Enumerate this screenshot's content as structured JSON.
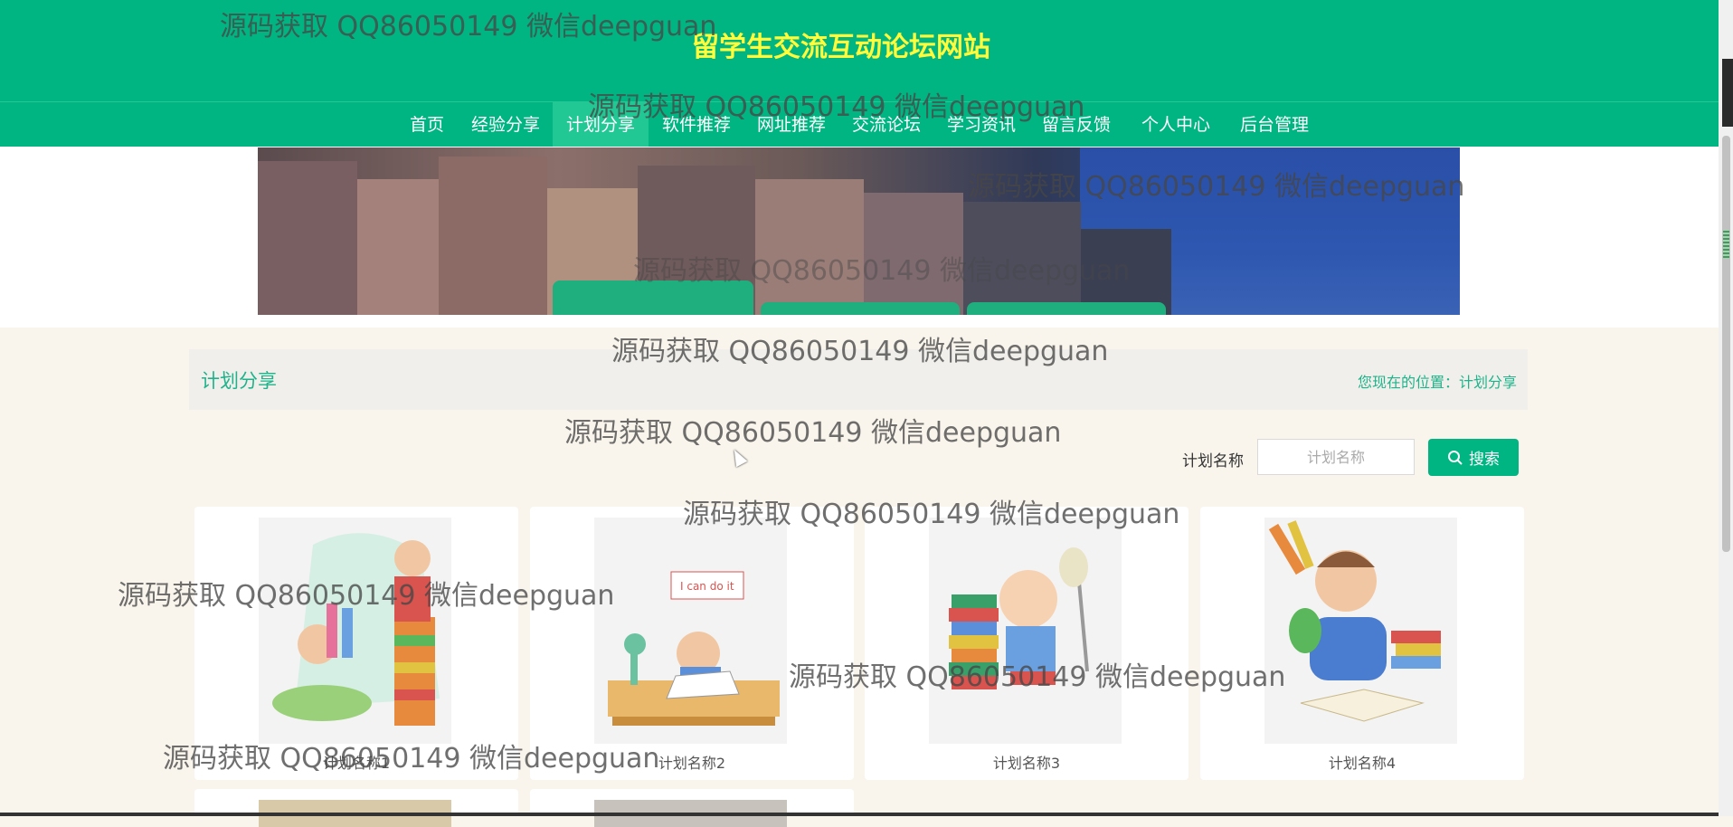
{
  "header": {
    "title": "留学生交流互动论坛网站"
  },
  "nav": {
    "items": [
      {
        "label": "首页"
      },
      {
        "label": "经验分享"
      },
      {
        "label": "计划分享"
      },
      {
        "label": "软件推荐"
      },
      {
        "label": "网址推荐"
      },
      {
        "label": "交流论坛"
      },
      {
        "label": "学习资讯"
      },
      {
        "label": "留言反馈"
      },
      {
        "label": "个人中心"
      },
      {
        "label": "后台管理"
      }
    ],
    "active": "计划分享"
  },
  "section": {
    "title": "计划分享",
    "breadcrumb": "您现在的位置：计划分享"
  },
  "search": {
    "label": "计划名称",
    "placeholder": "计划名称",
    "value": "",
    "button_label": "搜索"
  },
  "cards": [
    {
      "name": "计划名称1"
    },
    {
      "name": "计划名称2"
    },
    {
      "name": "计划名称3"
    },
    {
      "name": "计划名称4"
    }
  ],
  "watermark": {
    "text": "源码获取 QQ86050149 微信deepguan"
  },
  "colors": {
    "primary": "#00b582",
    "title_yellow": "#ffff3a",
    "page_background": "#f9f5ec"
  }
}
